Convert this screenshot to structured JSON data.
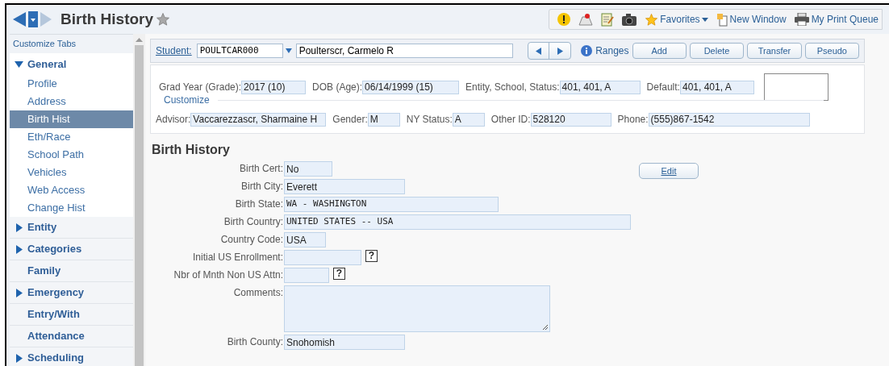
{
  "window": {
    "title": "Birth History"
  },
  "toolbar": {
    "favorites": "Favorites",
    "new_window": "New Window",
    "print_queue": "My Print Queue"
  },
  "sidebar": {
    "header": "Customize Tabs",
    "items": [
      {
        "label": "General",
        "expanded": true,
        "children": [
          {
            "label": "Profile",
            "selected": false
          },
          {
            "label": "Address",
            "selected": false
          },
          {
            "label": "Birth Hist",
            "selected": true
          },
          {
            "label": "Eth/Race",
            "selected": false
          },
          {
            "label": "School Path",
            "selected": false
          },
          {
            "label": "Vehicles",
            "selected": false
          },
          {
            "label": "Web Access",
            "selected": false
          },
          {
            "label": "Change Hist",
            "selected": false
          }
        ]
      },
      {
        "label": "Entity",
        "expanded": false
      },
      {
        "label": "Categories",
        "expanded": false
      },
      {
        "label": "Family"
      },
      {
        "label": "Emergency",
        "expanded": false
      },
      {
        "label": "Entry/With"
      },
      {
        "label": "Attendance"
      },
      {
        "label": "Scheduling",
        "expanded": false
      }
    ]
  },
  "student_bar": {
    "label": "Student:",
    "id": "POULTCAR000",
    "name": "Poulterscr, Carmelo R",
    "ranges": "Ranges",
    "buttons": [
      "Add",
      "Delete",
      "Transfer",
      "Pseudo"
    ]
  },
  "info": {
    "row_1": [
      {
        "label": "Grad Year (Grade):",
        "value": "2017 (10)"
      },
      {
        "label": "DOB (Age):",
        "value": "06/14/1999 (15)"
      },
      {
        "label": "Entity, School, Status:",
        "value": "401, 401, A"
      },
      {
        "label": "Default:",
        "value": "401, 401, A"
      }
    ],
    "customize": "Customize",
    "row_2": [
      {
        "label": "Advisor:",
        "value": "Vaccarezzascr, Sharmaine H"
      },
      {
        "label": "Gender:",
        "value": "M"
      },
      {
        "label": "NY Status:",
        "value": "A"
      },
      {
        "label": "Other ID:",
        "value": "528120"
      },
      {
        "label": "Phone:",
        "value": "(555)867-1542"
      }
    ]
  },
  "section": {
    "title": "Birth History",
    "edit_button": "Edit",
    "fields": [
      {
        "label": "Birth Cert:",
        "value": "No",
        "kind": "text"
      },
      {
        "label": "Birth City:",
        "value": "Everett",
        "kind": "text"
      },
      {
        "label": "Birth State:",
        "value": "WA - WASHINGTON",
        "kind": "code"
      },
      {
        "label": "Birth Country:",
        "value": "UNITED STATES -- USA",
        "kind": "code"
      },
      {
        "label": "Country Code:",
        "value": "USA",
        "kind": "text"
      },
      {
        "label": "Initial US Enrollment:",
        "kind": "text",
        "help": "?"
      },
      {
        "label": "Nbr of Mnth Non US Attn:",
        "kind": "text",
        "help": "?"
      },
      {
        "label": "Comments:",
        "kind": "area"
      },
      {
        "label": "Birth County:",
        "value": "Snohomish",
        "kind": "text"
      }
    ]
  }
}
